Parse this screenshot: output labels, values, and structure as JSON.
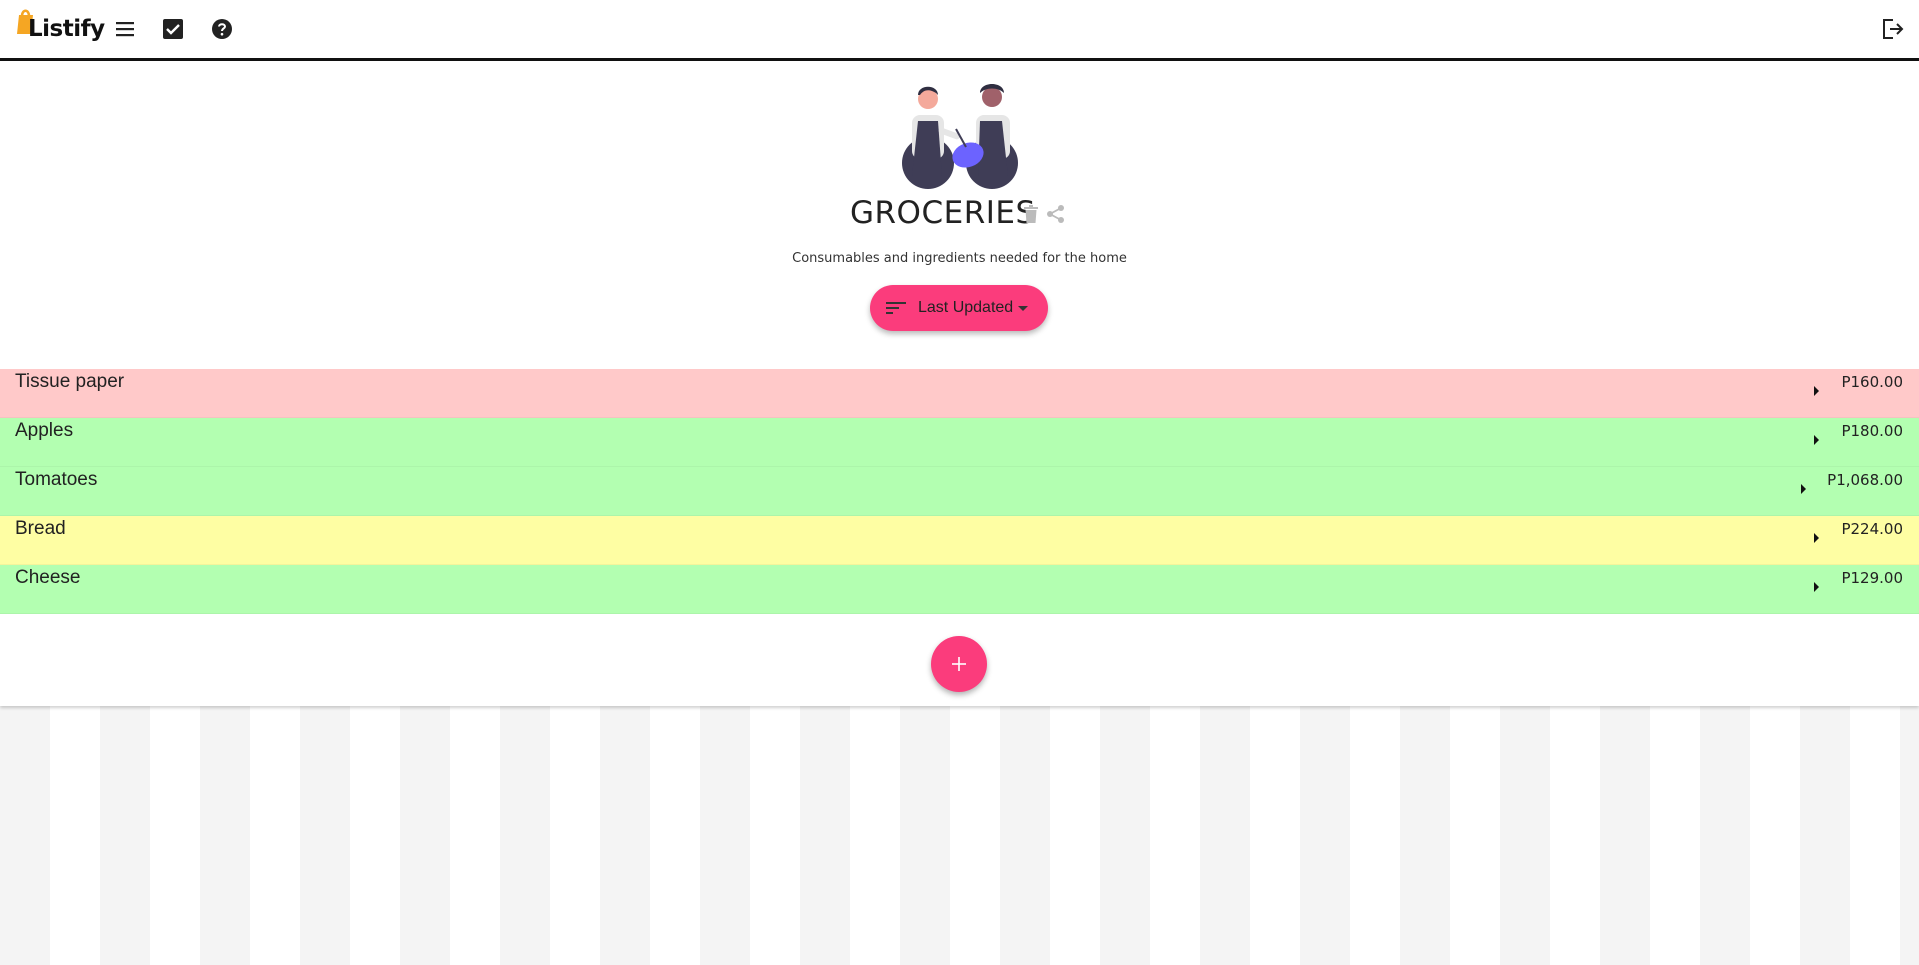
{
  "app": {
    "name": "Listify"
  },
  "toolbar": {
    "menu_icon": "menu-icon",
    "checklist_icon": "checkbox-icon",
    "help_icon": "help-icon",
    "logout_icon": "logout-icon"
  },
  "list": {
    "title": "GROCERIES",
    "description": "Consumables and ingredients needed for the home",
    "sort_label": "Last Updated"
  },
  "items": [
    {
      "name": "Tissue paper",
      "price": "P160.00",
      "color": "#ffc9c9"
    },
    {
      "name": "Apples",
      "price": "P180.00",
      "color": "#b3ffb1"
    },
    {
      "name": "Tomatoes",
      "price": "P1,068.00",
      "color": "#b3ffb1"
    },
    {
      "name": "Bread",
      "price": "P224.00",
      "color": "#fefea3"
    },
    {
      "name": "Cheese",
      "price": "P129.00",
      "color": "#b3ffb1"
    }
  ],
  "colors": {
    "accent": "#fb3c7c",
    "brand": "#f5a623"
  }
}
